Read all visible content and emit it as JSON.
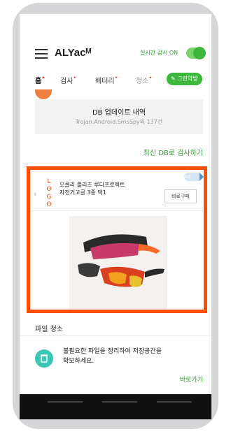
{
  "header": {
    "title": "ALYacᴹ",
    "realtime_label": "실시간 감시 ON",
    "toggle_on": true
  },
  "tabs": [
    {
      "label": "홈",
      "active": true,
      "dot": true
    },
    {
      "label": "검사",
      "dot": true
    },
    {
      "label": "배터리",
      "dot": true
    },
    {
      "label": "청소",
      "dot": true
    }
  ],
  "green_button": "그린약방",
  "db": {
    "title": "DB 업데이트 내역",
    "subtitle": "Trojan.Android.SmsSpy외 137건",
    "scan_link": "최신 DB로 검사하기"
  },
  "ad": {
    "logo": "LOGO",
    "line1": "오클리 블리츠 루디프로젝트",
    "line2": "자전거고글 3종 택1",
    "buy": "바로구매",
    "badge": "Ad"
  },
  "file_clean": {
    "section": "파일 청소",
    "line1": "불필요한 파일을 정리하여 저장공간을",
    "line2": "확보하세요.",
    "go": "바로가기"
  },
  "colors": {
    "accent": "#3cb83c",
    "ad_border": "#ff4d00",
    "trash": "#3cc7b4"
  },
  "icons": {
    "menu": "hamburger-icon",
    "trash": "trash-icon",
    "ad_choice": "ad-choices-icon"
  }
}
